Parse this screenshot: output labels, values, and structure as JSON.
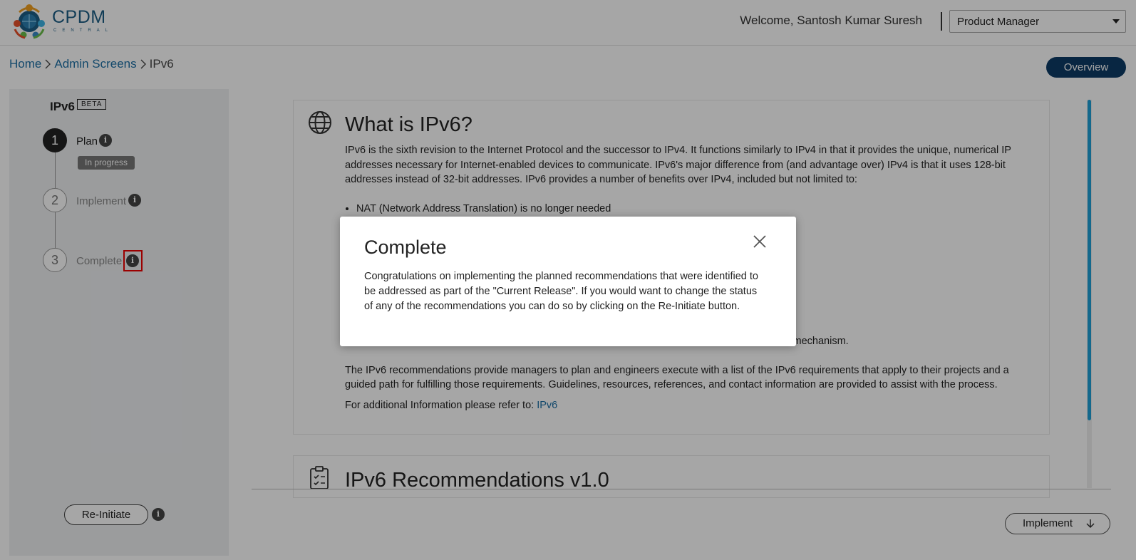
{
  "header": {
    "logo_title": "CPDM",
    "logo_subtitle": "CENTRAL",
    "welcome": "Welcome, Santosh Kumar Suresh",
    "role_selected": "Product Manager"
  },
  "breadcrumb": {
    "home": "Home",
    "admin": "Admin Screens",
    "current": "IPv6"
  },
  "overview_label": "Overview",
  "stepper": {
    "title": "IPv6",
    "badge": "BETA",
    "steps": [
      {
        "number": "1",
        "label": "Plan",
        "status": "In progress"
      },
      {
        "number": "2",
        "label": "Implement"
      },
      {
        "number": "3",
        "label": "Complete"
      }
    ],
    "info_glyph": "i",
    "reinitiate_label": "Re-Initiate"
  },
  "card": {
    "title": "What is IPv6?",
    "intro": "IPv6 is the sixth revision to the Internet Protocol and the successor to IPv4. It functions similarly to IPv4 in that it provides the unique, numerical IP addresses necessary for Internet-enabled devices to communicate. IPv6's major difference from (and advantage over) IPv4 is that it uses 128-bit addresses instead of 32-bit addresses. IPv6 provides a number of benefits over IPv4, included but not limited to:",
    "bullet_first": "NAT (Network Address Translation) is no longer needed",
    "bullet_last": "Easier administration. DHCPv6 will still be used, but SLAAC can also be used as an alternative mechanism.",
    "description": "The IPv6 recommendations provide managers to plan and engineers execute with a list of the IPv6 requirements that apply to their projects and a guided path for fulfilling those requirements. Guidelines, resources, references, and contact information are provided to assist with the process.",
    "more_info_prefix": "For additional Information please refer to: ",
    "more_info_link": "IPv6"
  },
  "card2": {
    "title": "IPv6 Recommendations v1.0"
  },
  "implement_label": "Implement",
  "modal": {
    "title": "Complete",
    "body": "Congratulations on implementing the planned recommendations that were identified to be addressed as part of the \"Current Release\". If you would want to change the status of any of the recommendations you can do so by clicking on the Re-Initiate button."
  },
  "colors": {
    "brand": "#1d5f86",
    "overview_bg": "#0d3b66",
    "link": "#1d6fa5",
    "scrollbar": "#1ea0d8",
    "highlight": "#e00000"
  }
}
